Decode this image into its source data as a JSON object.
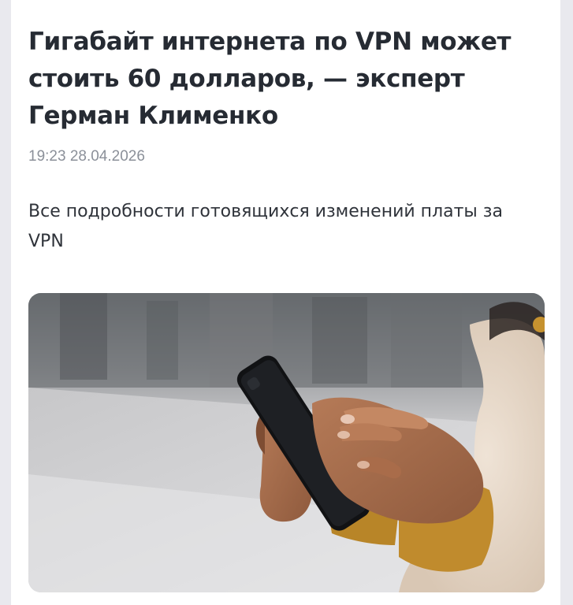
{
  "article": {
    "headline": "Гигабайт интернета по VPN может стоить 60 долларов, — эксперт Герман Клименко",
    "timestamp": "19:23 28.04.2026",
    "lead": "Все подробности готовящихся изменений платы за VPN"
  },
  "photo": {
    "description_icon": "person-holding-smartphone-image"
  }
}
